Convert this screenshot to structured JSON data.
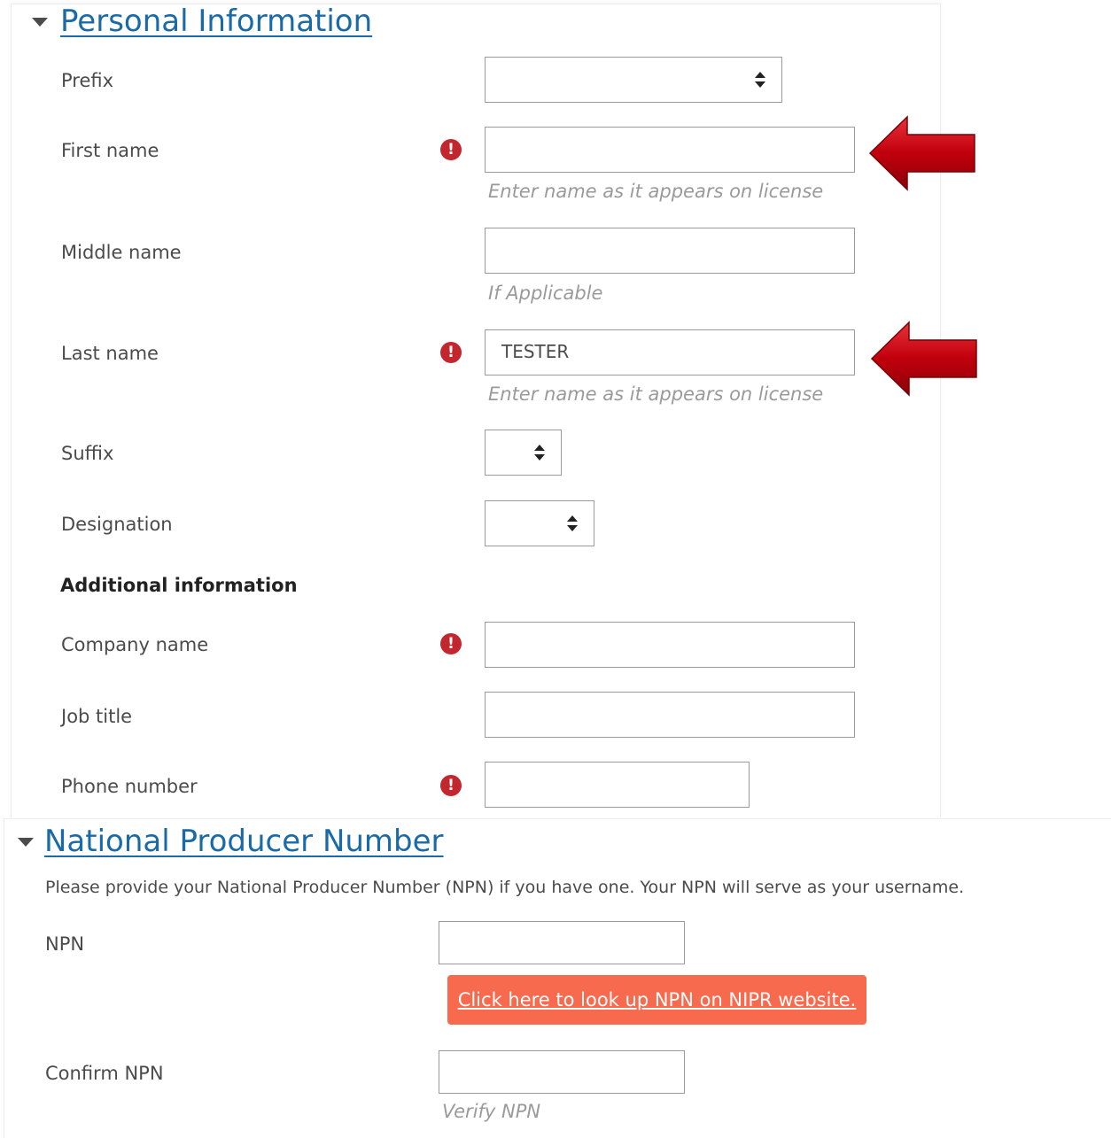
{
  "personal_info": {
    "title": "Personal Information",
    "fields": {
      "prefix": {
        "label": "Prefix",
        "value": ""
      },
      "first_name": {
        "label": "First name",
        "value": "",
        "hint": "Enter name as it appears on license",
        "required_icon": "!"
      },
      "middle_name": {
        "label": "Middle name",
        "value": "",
        "hint": "If Applicable"
      },
      "last_name": {
        "label": "Last name",
        "value": "TESTER",
        "hint": "Enter name as it appears on license",
        "required_icon": "!"
      },
      "suffix": {
        "label": "Suffix",
        "value": ""
      },
      "designation": {
        "label": "Designation",
        "value": ""
      }
    },
    "additional_heading": "Additional information",
    "additional_fields": {
      "company_name": {
        "label": "Company name",
        "value": "",
        "required_icon": "!"
      },
      "job_title": {
        "label": "Job title",
        "value": ""
      },
      "phone_number": {
        "label": "Phone number",
        "value": "",
        "required_icon": "!"
      }
    }
  },
  "npn_section": {
    "title": "National Producer Number",
    "description": "Please provide your National Producer Number (NPN) if you have one. Your NPN will serve as your username.",
    "npn": {
      "label": "NPN",
      "value": ""
    },
    "lookup_button": "Click here to look up NPN on NIPR website.",
    "confirm_npn": {
      "label": "Confirm NPN",
      "value": "",
      "hint": "Verify NPN"
    }
  },
  "icons": {
    "section_toggle": "caret-down-icon",
    "required": "exclamation-circle-icon",
    "select_arrows": "sort-updown-icon",
    "annotation": "red-arrow-left-icon"
  },
  "colors": {
    "link": "#1a6aa8",
    "required": "#c1272d",
    "button": "#f86a4e",
    "annotation_arrow": "#c0000c"
  }
}
